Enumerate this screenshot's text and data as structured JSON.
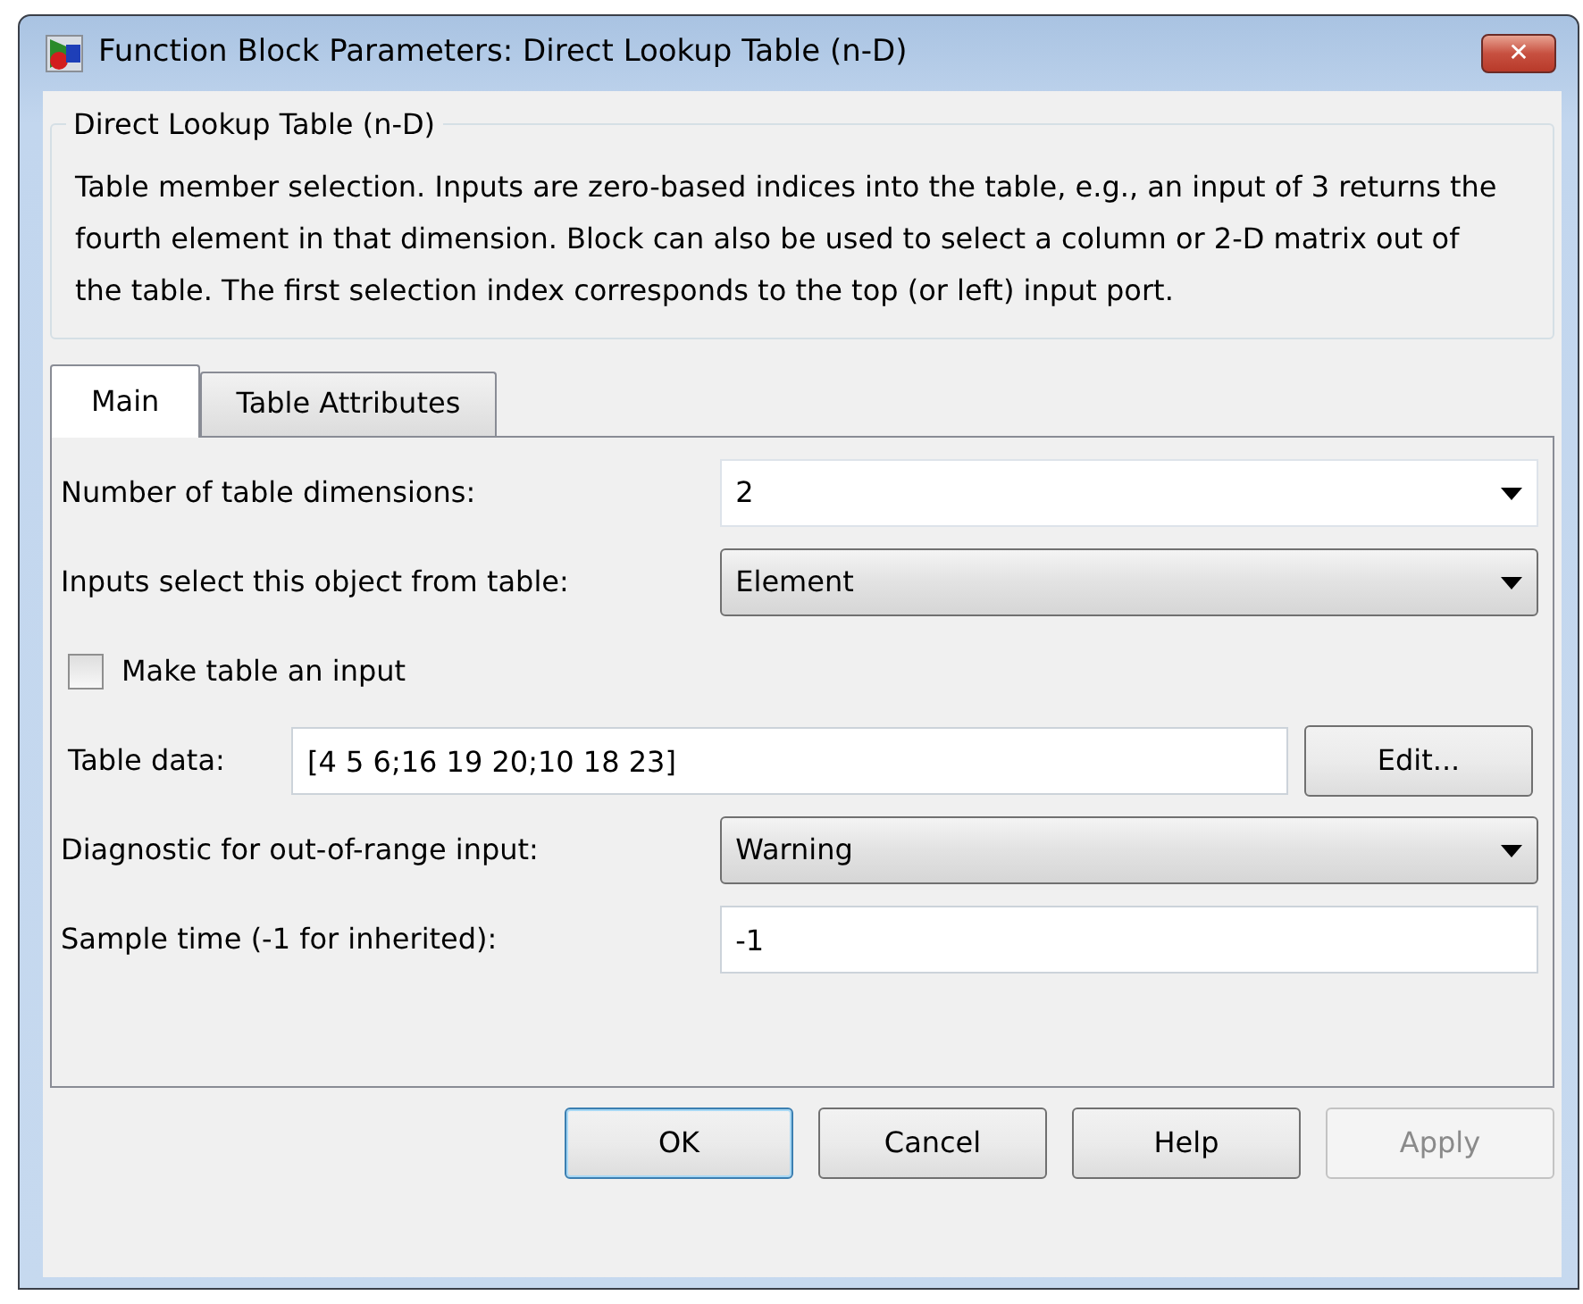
{
  "window": {
    "title": "Function Block Parameters: Direct Lookup Table (n-D)",
    "close": "✕"
  },
  "group": {
    "title": "Direct Lookup Table (n-D)",
    "description": "Table member selection.  Inputs are zero-based indices into the table, e.g., an input of 3 returns the fourth element in that dimension. Block can also be used to select a column or 2-D matrix out of the table. The first selection index corresponds to the top (or left) input port."
  },
  "tabs": [
    {
      "label": "Main",
      "selected": true
    },
    {
      "label": "Table Attributes",
      "selected": false
    }
  ],
  "parameters": [
    {
      "kind": "editable-dropdown",
      "label": "Number of table dimensions:",
      "value": "2"
    },
    {
      "kind": "dropdown",
      "label": "Inputs select this object from table:",
      "value": "Element"
    },
    {
      "kind": "checkbox",
      "label": "Make table an input",
      "checked": false
    },
    {
      "kind": "text-with-button",
      "label": "Table data:",
      "value": "[4 5 6;16 19 20;10 18 23]",
      "button": "Edit..."
    },
    {
      "kind": "dropdown",
      "label": "Diagnostic for out-of-range input:",
      "value": "Warning"
    },
    {
      "kind": "text",
      "label": "Sample time (-1 for inherited):",
      "value": "-1"
    }
  ],
  "buttons": [
    {
      "label": "OK",
      "default": true,
      "disabled": false
    },
    {
      "label": "Cancel",
      "default": false,
      "disabled": false
    },
    {
      "label": "Help",
      "default": false,
      "disabled": false
    },
    {
      "label": "Apply",
      "default": false,
      "disabled": true
    }
  ]
}
